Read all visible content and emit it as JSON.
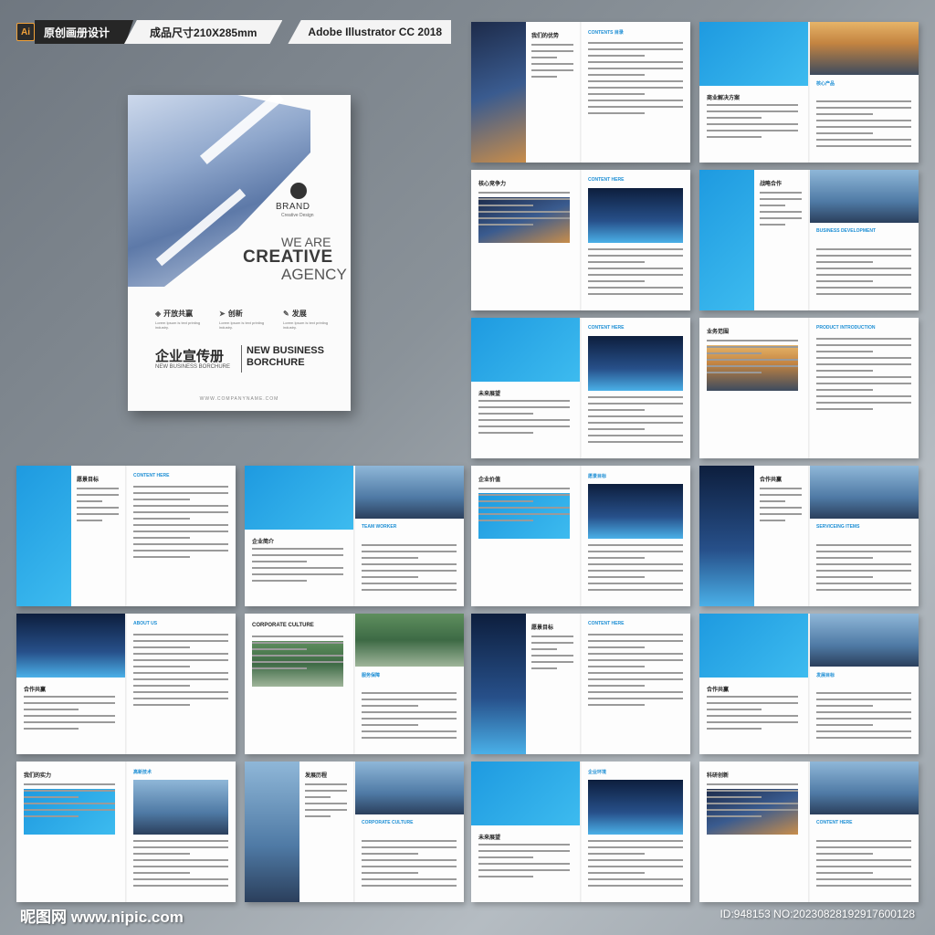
{
  "header": {
    "ai_badge": "Ai",
    "label": "原创画册设计",
    "size": "成品尺寸210X285mm",
    "software": "Adobe Illustrator CC 2018"
  },
  "cover": {
    "brand": "BRAND",
    "brand_sub": "Creative Design",
    "we_are": "WE ARE",
    "creative": "CREATIVE",
    "agency": "AGENCY",
    "features": [
      {
        "title": "开放共赢",
        "desc": "Lorem Ipsum is text printing industry."
      },
      {
        "title": "创新",
        "desc": "Lorem Ipsum is text printing industry."
      },
      {
        "title": "发展",
        "desc": "Lorem Ipsum is text printing industry."
      }
    ],
    "cn_title": "企业宣传册",
    "cn_sub": "NEW BUSINESS BORCHURE",
    "en_title_1": "NEW BUSINESS",
    "en_title_2": "BORCHURE",
    "url": "WWW.COMPANYNAME.COM"
  },
  "spreads": [
    {
      "title": "我们的优势",
      "alt": "CONTENTS 目录"
    },
    {
      "title": "商业解决方案",
      "alt": "核心产品"
    },
    {
      "title": "核心竞争力",
      "alt": "CONTENT HERE"
    },
    {
      "title": "战略合作",
      "alt": "BUSINESS DEVELOPMENT"
    },
    {
      "title": "未来展望",
      "alt": "CONTENT HERE"
    },
    {
      "title": "业务范围",
      "alt": "PRODUCT INTRODUCTION"
    },
    {
      "title": "愿景目标",
      "alt": "CONTENT HERE"
    },
    {
      "title": "企业简介",
      "alt": "TEAM WORKER"
    },
    {
      "title": "企业价值",
      "alt": "愿景目标"
    },
    {
      "title": "合作共赢",
      "alt": "SERVICEING ITEMS"
    },
    {
      "title": "合作共赢",
      "alt": "ABOUT US"
    },
    {
      "title": "CORPORATE CULTURE",
      "alt": "服务保障"
    },
    {
      "title": "愿景目标",
      "alt": "CONTENT HERE"
    },
    {
      "title": "合作共赢",
      "alt": "发展目标"
    },
    {
      "title": "我们的实力",
      "alt": "高新技术"
    },
    {
      "title": "发展历程",
      "alt": "CORPORATE CULTURE"
    },
    {
      "title": "未来展望",
      "alt": "企业环境"
    },
    {
      "title": "科研创新",
      "alt": "CONTENT HERE"
    }
  ],
  "footer": {
    "logo": "昵图网 www.nipic.com",
    "id": "ID:948153 NO:20230828192917600128"
  }
}
